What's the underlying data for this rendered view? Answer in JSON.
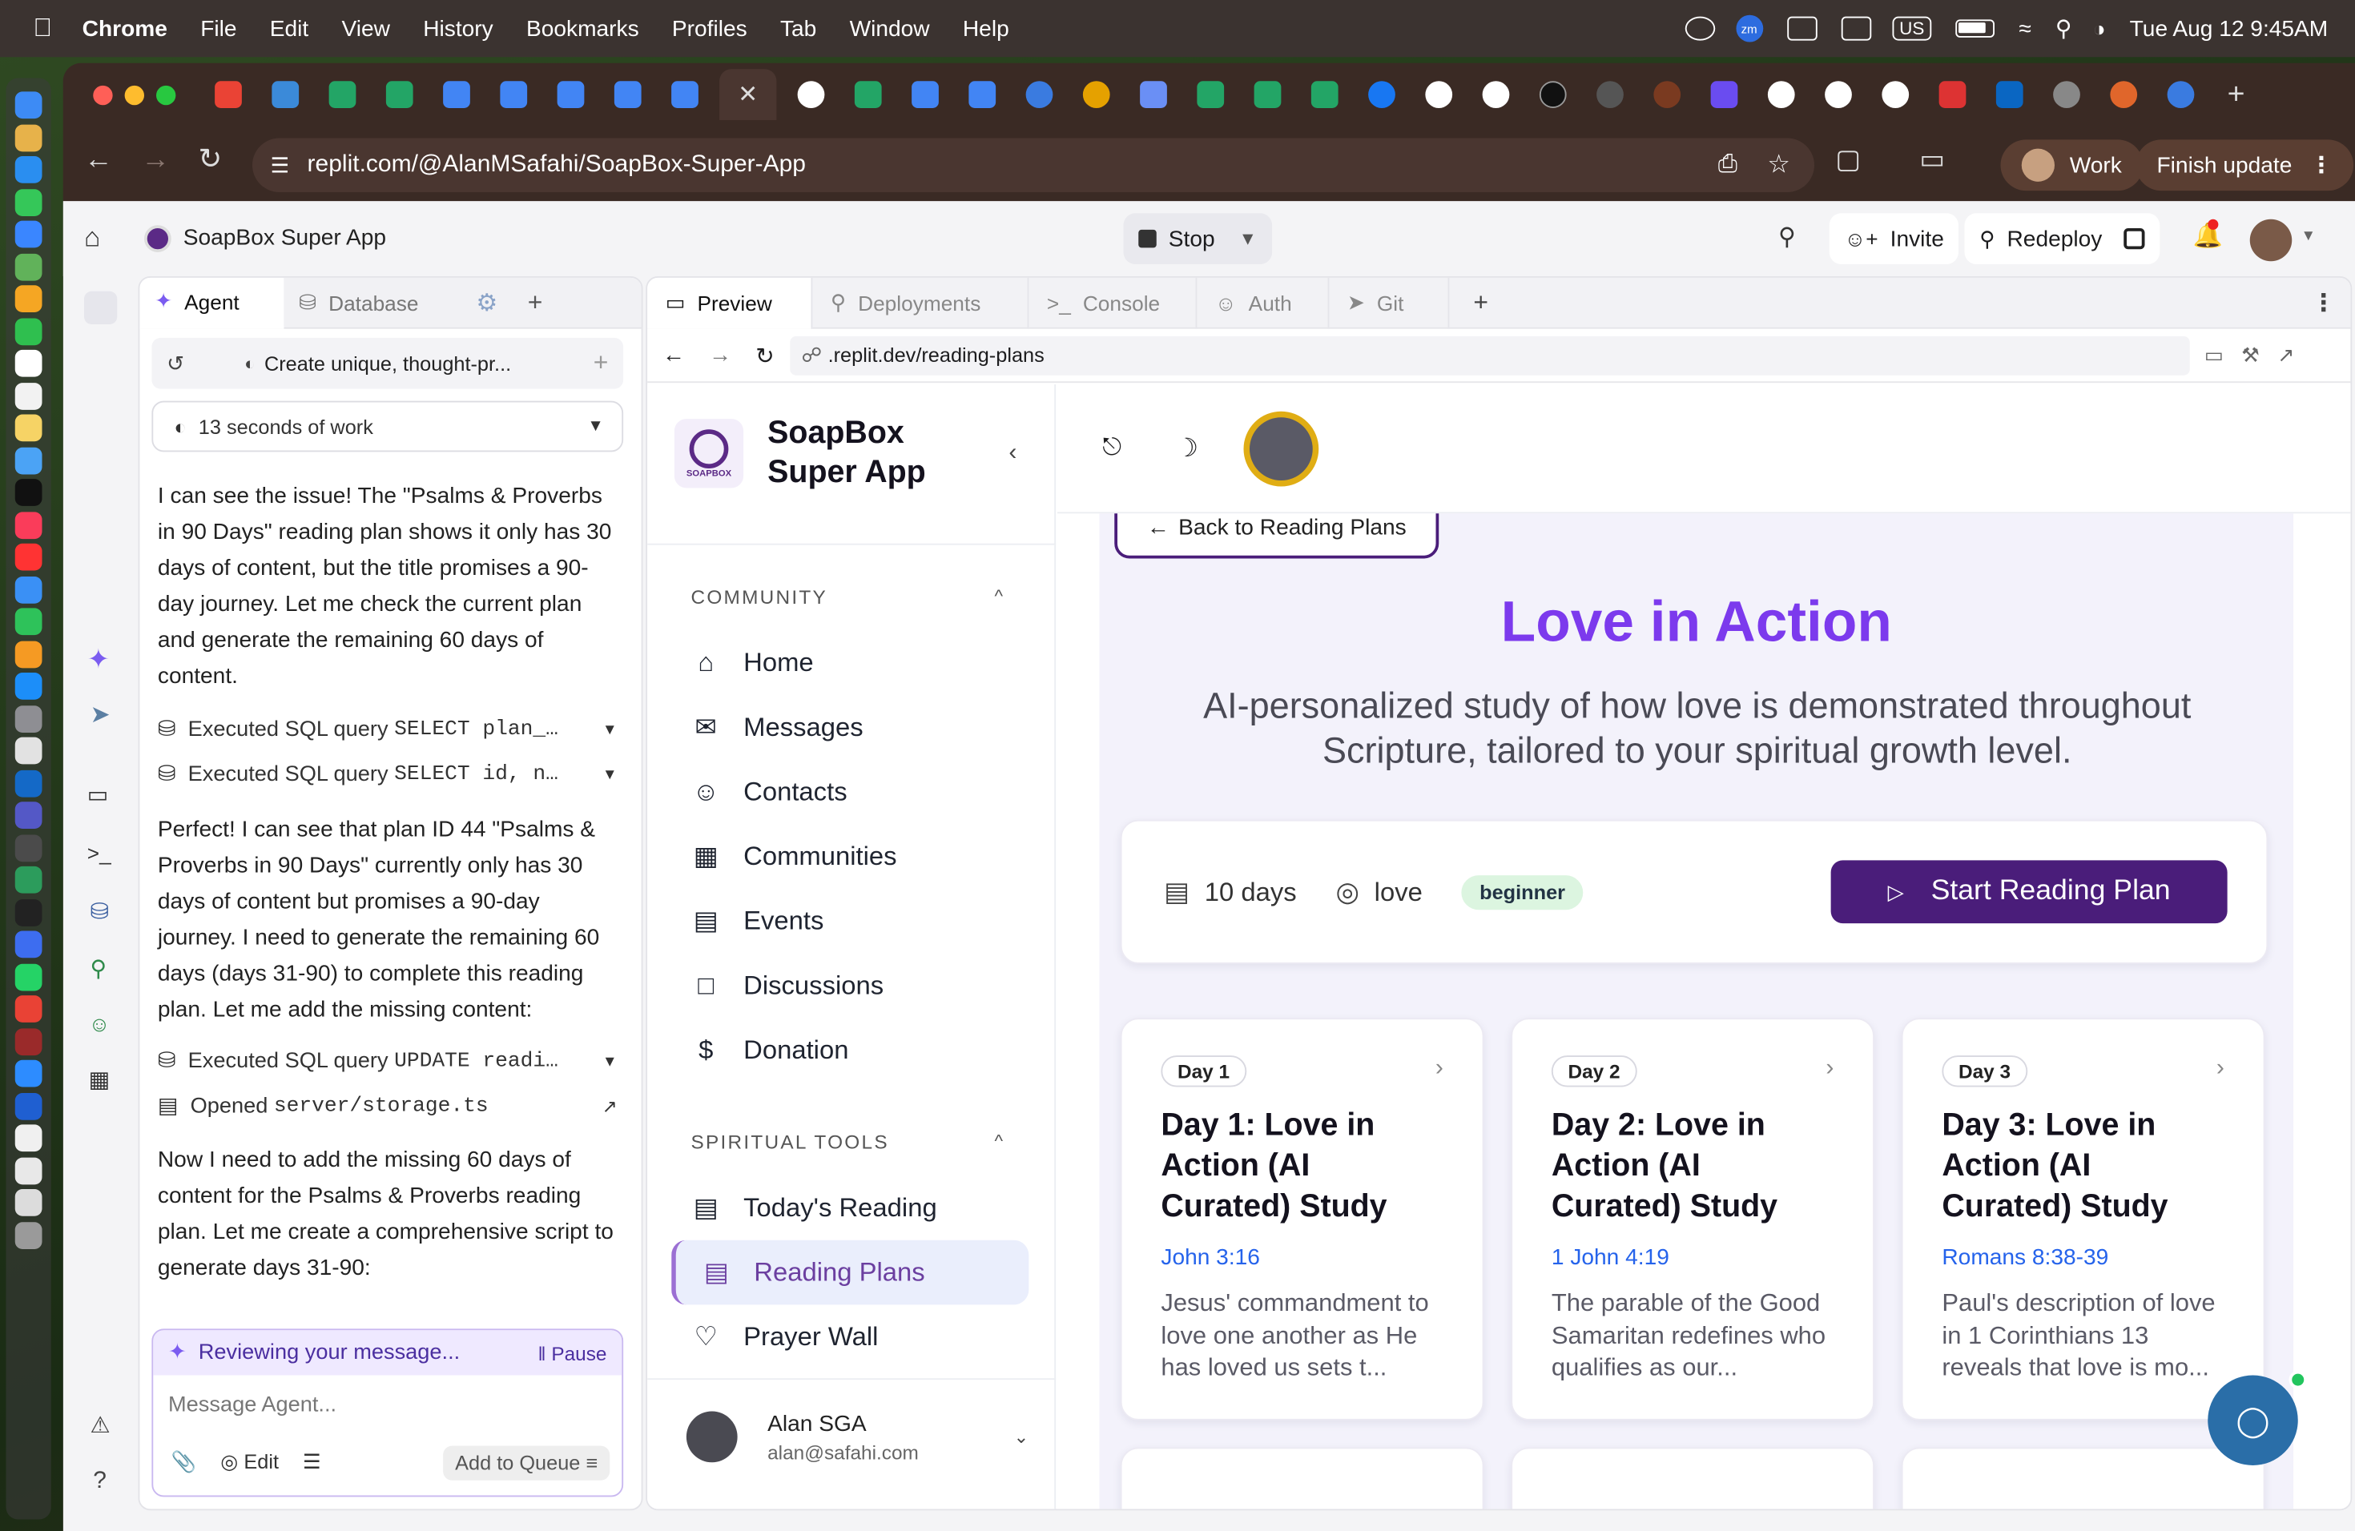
{
  "menubar": {
    "app": "Chrome",
    "items": [
      "File",
      "Edit",
      "View",
      "History",
      "Bookmarks",
      "Profiles",
      "Tab",
      "Window",
      "Help"
    ],
    "datetime": "Tue Aug 12  9:45AM",
    "zoom_badge": "zm",
    "keyboard": "US"
  },
  "browser": {
    "url": "replit.com/@AlanMSafahi/SoapBox-Super-App",
    "profile": "Work",
    "update_button": "Finish update"
  },
  "replit": {
    "project_title": "SoapBox Super App",
    "stop_label": "Stop",
    "invite_label": "Invite",
    "redeploy_label": "Redeploy",
    "agent_tabs": {
      "agent": "Agent",
      "database": "Database"
    },
    "task_title": "Create unique, thought-pr...",
    "work_time": "13 seconds of work",
    "msg1": "I can see the issue! The \"Psalms & Proverbs in 90 Days\" reading plan shows it only has 30 days of content, but the title promises a 90-day journey. Let me check the current plan and generate the remaining 60 days of content.",
    "tool1": "Executed SQL query",
    "tool1_code": "SELECT plan_…",
    "tool2": "Executed SQL query",
    "tool2_code": "SELECT id, n…",
    "msg2": "Perfect! I can see that plan ID 44 \"Psalms & Proverbs in 90 Days\" currently only has 30 days of content but promises a 90-day journey. I need to generate the remaining 60 days (days 31-90) to complete this reading plan. Let me add the missing content:",
    "tool3": "Executed SQL query",
    "tool3_code": "UPDATE readi…",
    "tool4": "Opened",
    "tool4_code": "server/storage.ts",
    "msg3": "Now I need to add the missing 60 days of content for the Psalms & Proverbs reading plan. Let me create a comprehensive script to generate days 31-90:",
    "reviewing": "Reviewing your message...",
    "pause": "Pause",
    "input_placeholder": "Message Agent...",
    "edit_label": "Edit",
    "queue_label": "Add to Queue",
    "pane_tabs": {
      "preview": "Preview",
      "deployments": "Deployments",
      "console": "Console",
      "auth": "Auth",
      "git": "Git"
    },
    "preview_url": ".replit.dev/reading-plans"
  },
  "site": {
    "brand": "SoapBox Super App",
    "logo_text": "SOAPBOX",
    "sections": {
      "community": "COMMUNITY",
      "tools": "SPIRITUAL TOOLS"
    },
    "nav": {
      "home": "Home",
      "messages": "Messages",
      "contacts": "Contacts",
      "communities": "Communities",
      "events": "Events",
      "discussions": "Discussions",
      "donation": "Donation",
      "todays_reading": "Today's Reading",
      "reading_plans": "Reading Plans",
      "prayer_wall": "Prayer Wall"
    },
    "user": {
      "name": "Alan SGA",
      "email": "alan@safahi.com"
    },
    "back": "Back to Reading Plans",
    "plan": {
      "title": "Love in Action",
      "description": "AI-personalized study of how love is demonstrated throughout Scripture, tailored to your spiritual growth level.",
      "days": "10 days",
      "topic": "love",
      "level": "beginner",
      "start": "Start Reading Plan"
    },
    "days": [
      {
        "badge": "Day 1",
        "title": "Day 1: Love in Action (AI Curated) Study",
        "ref": "John 3:16",
        "desc": "Jesus' commandment to love one another as He has loved us sets t..."
      },
      {
        "badge": "Day 2",
        "title": "Day 2: Love in Action (AI Curated) Study",
        "ref": "1 John 4:19",
        "desc": "The parable of the Good Samaritan redefines who qualifies as our..."
      },
      {
        "badge": "Day 3",
        "title": "Day 3: Love in Action (AI Curated) Study",
        "ref": "Romans 8:38-39",
        "desc": "Paul's description of love in 1 Corinthians 13 reveals that love is mo..."
      }
    ],
    "colors": {
      "accent": "#6b2fa0",
      "brand_title": "#7c3aed",
      "primary_button": "#4a1d7a"
    }
  }
}
